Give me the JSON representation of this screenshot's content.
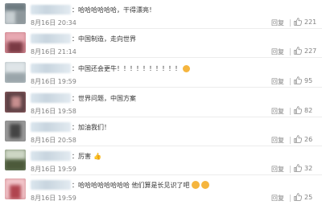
{
  "comments": [
    {
      "text": "：哈哈哈哈哈哈，干得漂亮！",
      "time": "8月16日 20:34",
      "reply_label": "回复",
      "likes": "221",
      "emoji": "none",
      "avatar_color": "#9aa3a8"
    },
    {
      "text": "：中国制造，走向世界",
      "time": "8月16日 21:14",
      "reply_label": "回复",
      "likes": "227",
      "emoji": "none",
      "avatar_color": "#c9808a"
    },
    {
      "text": "：中国还会更牛！！！！！！！！！！",
      "time": "8月16日 19:59",
      "reply_label": "回复",
      "likes": "95",
      "emoji": "thumbs-up",
      "avatar_color": "#b7c0c4"
    },
    {
      "text": "：世界问题，中国方案",
      "time": "8月16日 19:58",
      "reply_label": "回复",
      "likes": "82",
      "emoji": "none",
      "avatar_color": "#a06a6e"
    },
    {
      "text": "：加油我们！",
      "time": "8月16日 20:58",
      "reply_label": "回复",
      "likes": "26",
      "emoji": "none",
      "avatar_color": "#8a8a8a"
    },
    {
      "text": "：厉害",
      "time": "8月16日 19:59",
      "reply_label": "回复",
      "likes": "32",
      "emoji": "thumbs-up-dark",
      "avatar_color": "#7a8a6e"
    },
    {
      "text": "：哈哈哈哈哈哈哈哈   他们算是长见识了吧",
      "time": "8月16日 19:59",
      "reply_label": "回复",
      "likes": "25",
      "emoji": "laugh-cry-double",
      "avatar_color": "#d08a90"
    }
  ]
}
